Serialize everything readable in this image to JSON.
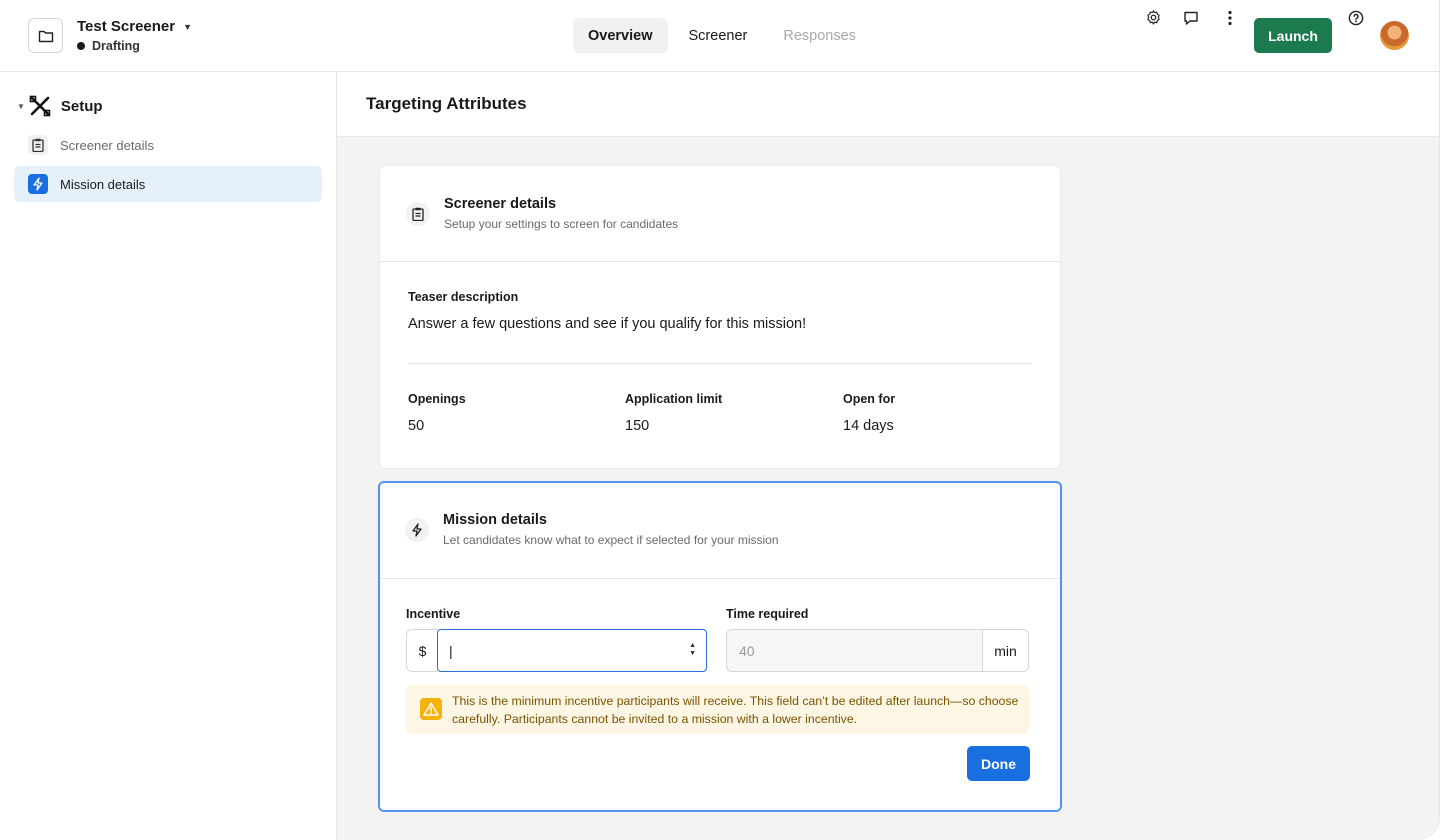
{
  "header": {
    "project_title": "Test Screener",
    "project_status": "Drafting",
    "tabs": [
      {
        "label": "Overview",
        "state": "active"
      },
      {
        "label": "Screener",
        "state": "normal"
      },
      {
        "label": "Responses",
        "state": "disabled"
      }
    ],
    "launch_label": "Launch",
    "icons": [
      "folder-icon",
      "gear-icon",
      "chat-icon",
      "more-vertical-icon",
      "help-icon",
      "avatar"
    ]
  },
  "sidebar": {
    "section_label": "Setup",
    "items": [
      {
        "label": "Screener details",
        "icon": "clipboard-icon",
        "selected": false
      },
      {
        "label": "Mission details",
        "icon": "lightning-icon",
        "selected": true
      }
    ]
  },
  "main": {
    "title": "Targeting Attributes",
    "screener_card": {
      "title": "Screener details",
      "subtitle": "Setup your settings to screen for candidates",
      "teaser_label": "Teaser description",
      "teaser_value": "Answer a few questions and see if you qualify for this mission!",
      "fields": [
        {
          "label": "Openings",
          "value": "50"
        },
        {
          "label": "Application limit",
          "value": "150"
        },
        {
          "label": "Open for",
          "value": "14 days"
        }
      ]
    },
    "mission_card": {
      "title": "Mission details",
      "subtitle": "Let candidates know what to expect if selected for your mission",
      "incentive_label": "Incentive",
      "incentive_prefix": "$",
      "incentive_value": "|",
      "time_label": "Time required",
      "time_placeholder": "40",
      "time_suffix": "min",
      "warning_text": "This is the minimum incentive participants will receive. This field can’t be edited after launch—so choose carefully. Participants cannot be invited to a mission with a lower incentive.",
      "done_label": "Done"
    }
  },
  "colors": {
    "launch_green": "#1c7a4f",
    "primary_blue": "#1a6fe0",
    "selected_bg": "#e6f0fb",
    "warning_bg": "#fdf6e4",
    "warning_icon": "#f6b10a"
  }
}
